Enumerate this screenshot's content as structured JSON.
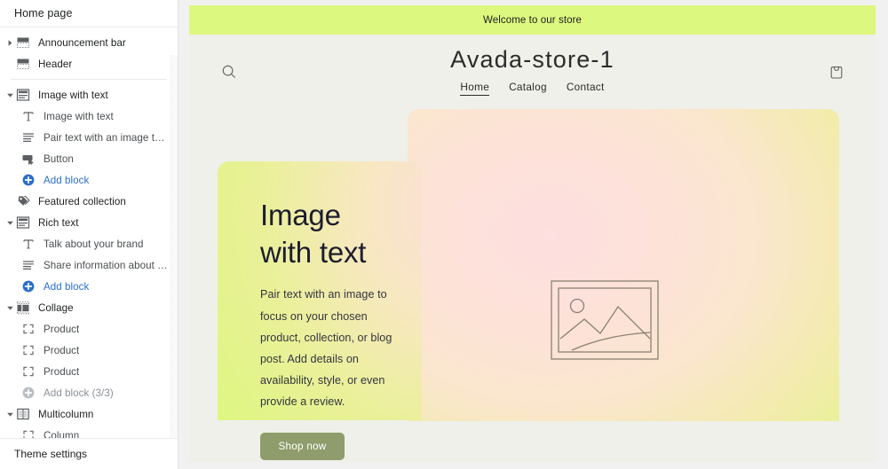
{
  "sidebar": {
    "title": "Home page",
    "footer_label": "Theme settings",
    "tree": [
      {
        "label": "Announcement bar",
        "kind": "section",
        "icon": "bar-section-icon",
        "caret": "collapsed"
      },
      {
        "label": "Header",
        "kind": "section",
        "icon": "bar-section-icon",
        "caret": "none"
      },
      {
        "label": "__SEPARATOR__",
        "kind": "separator",
        "icon": "",
        "caret": "none"
      },
      {
        "label": "Image with text",
        "kind": "section",
        "icon": "image-text-section-icon",
        "caret": "expanded"
      },
      {
        "label": "Image with text",
        "kind": "block",
        "icon": "text-heading-icon",
        "caret": "none"
      },
      {
        "label": "Pair text with an image to focu...",
        "kind": "block",
        "icon": "paragraph-icon",
        "caret": "none"
      },
      {
        "label": "Button",
        "kind": "block",
        "icon": "button-icon",
        "caret": "none"
      },
      {
        "label": "Add block",
        "kind": "addblock",
        "icon": "add-circle-icon",
        "caret": "none"
      },
      {
        "label": "Featured collection",
        "kind": "section",
        "icon": "price-tag-icon",
        "caret": "none"
      },
      {
        "label": "Rich text",
        "kind": "section",
        "icon": "image-text-section-icon",
        "caret": "expanded"
      },
      {
        "label": "Talk about your brand",
        "kind": "block",
        "icon": "text-heading-icon",
        "caret": "none"
      },
      {
        "label": "Share information about your b...",
        "kind": "block",
        "icon": "paragraph-icon",
        "caret": "none"
      },
      {
        "label": "Add block",
        "kind": "addblock",
        "icon": "add-circle-icon",
        "caret": "none"
      },
      {
        "label": "Collage",
        "kind": "section",
        "icon": "collage-icon",
        "caret": "expanded"
      },
      {
        "label": "Product",
        "kind": "block",
        "icon": "product-frame-icon",
        "caret": "none"
      },
      {
        "label": "Product",
        "kind": "block",
        "icon": "product-frame-icon",
        "caret": "none"
      },
      {
        "label": "Product",
        "kind": "block",
        "icon": "product-frame-icon",
        "caret": "none"
      },
      {
        "label": "Add block (3/3)",
        "kind": "addblock-dim",
        "icon": "add-circle-icon",
        "caret": "none"
      },
      {
        "label": "Multicolumn",
        "kind": "section",
        "icon": "multicolumn-icon",
        "caret": "expanded"
      },
      {
        "label": "Column",
        "kind": "block",
        "icon": "product-frame-icon",
        "caret": "none"
      }
    ]
  },
  "preview": {
    "announcement": "Welcome to our store",
    "store_title": "Avada-store-1",
    "search_icon": "search-icon",
    "cart_icon": "shopping-bag-icon",
    "nav": [
      {
        "label": "Home",
        "active": true
      },
      {
        "label": "Catalog",
        "active": false
      },
      {
        "label": "Contact",
        "active": false
      }
    ],
    "image_with_text": {
      "heading_line1": "Image",
      "heading_line2": "with text",
      "body": "Pair text with an image to focus on your chosen product, collection, or blog post. Add details on availability, style, or even provide a review.",
      "button_label": "Shop now",
      "placeholder_icon": "image-placeholder-icon"
    }
  },
  "colors": {
    "announcement_bg": "#ddf87f",
    "page_bg": "#eef0e9",
    "button_bg": "#8f9c6b",
    "link_blue": "#2c6ecb",
    "text_dark": "#202223"
  }
}
